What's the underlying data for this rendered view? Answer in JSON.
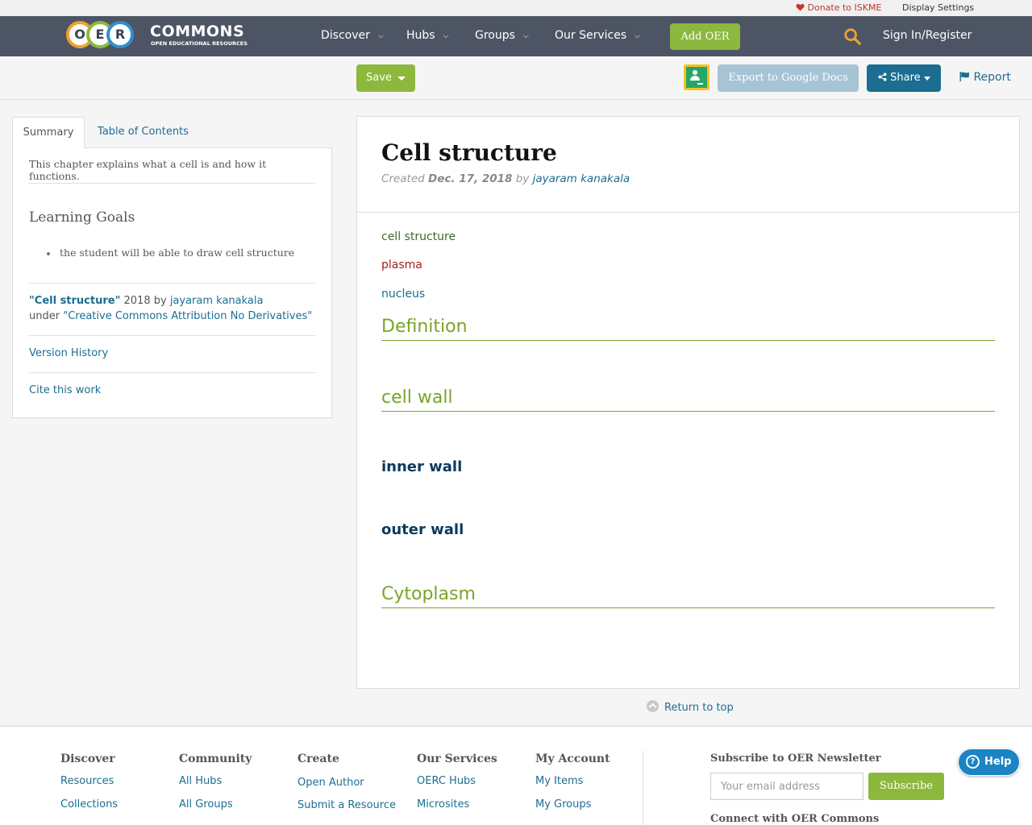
{
  "utility": {
    "donate": "Donate to ISKME",
    "display_settings": "Display Settings"
  },
  "nav": {
    "logo_letters": [
      "O",
      "E",
      "R"
    ],
    "logo_word": "COMMONS",
    "logo_sub": "OPEN EDUCATIONAL RESOURCES",
    "items": [
      {
        "label": "Discover"
      },
      {
        "label": "Hubs"
      },
      {
        "label": "Groups"
      },
      {
        "label": "Our Services"
      }
    ],
    "add_oer": "Add OER",
    "sign_in": "Sign In/Register"
  },
  "toolbar": {
    "save": "Save",
    "export": "Export to Google Docs",
    "share": "Share",
    "report": "Report"
  },
  "sidebar": {
    "tabs": [
      {
        "label": "Summary"
      },
      {
        "label": "Table of Contents"
      }
    ],
    "description": "This chapter explains what a cell is and how it functions.",
    "learning_goals_title": "Learning Goals",
    "learning_goals": [
      "the student will be able to draw cell structure"
    ],
    "attribution": {
      "title": "\"Cell structure\"",
      "year_by": " 2018 by ",
      "author": "jayaram kanakala",
      "under": "under ",
      "license": "\"Creative Commons Attribution No Derivatives\""
    },
    "version_history": "Version History",
    "cite": "Cite this work"
  },
  "document": {
    "title": "Cell structure",
    "created_label": "Created ",
    "date": "Dec. 17, 2018",
    "by_label": " by ",
    "author": "jayaram kanakala",
    "lines": [
      "cell structure",
      "plasma",
      "nucleus"
    ],
    "sections": [
      "Definition",
      "cell wall",
      "Cytoplasm"
    ],
    "subheadings": [
      "inner wall",
      "outer wall"
    ]
  },
  "return_to_top": "Return to top",
  "footer": {
    "columns": [
      {
        "heading": "Discover",
        "links": [
          "Resources",
          "Collections"
        ]
      },
      {
        "heading": "Community",
        "links": [
          "All Hubs",
          "All Groups"
        ]
      },
      {
        "heading": "Create",
        "links": [
          "Open Author",
          "Submit a Resource"
        ]
      },
      {
        "heading": "Our Services",
        "links": [
          "OERC Hubs",
          "Microsites"
        ]
      },
      {
        "heading": "My Account",
        "links": [
          "My Items",
          "My Groups"
        ]
      }
    ],
    "newsletter_title": "Subscribe to OER Newsletter",
    "email_placeholder": "Your email address",
    "subscribe": "Subscribe",
    "connect": "Connect with OER Commons"
  },
  "help": "Help",
  "colors": {
    "navbar": "#4d5565",
    "accent_green": "#8cb83e",
    "link_blue": "#1b6e91",
    "heading_green": "#7aa428",
    "donate_red": "#c0392b"
  }
}
